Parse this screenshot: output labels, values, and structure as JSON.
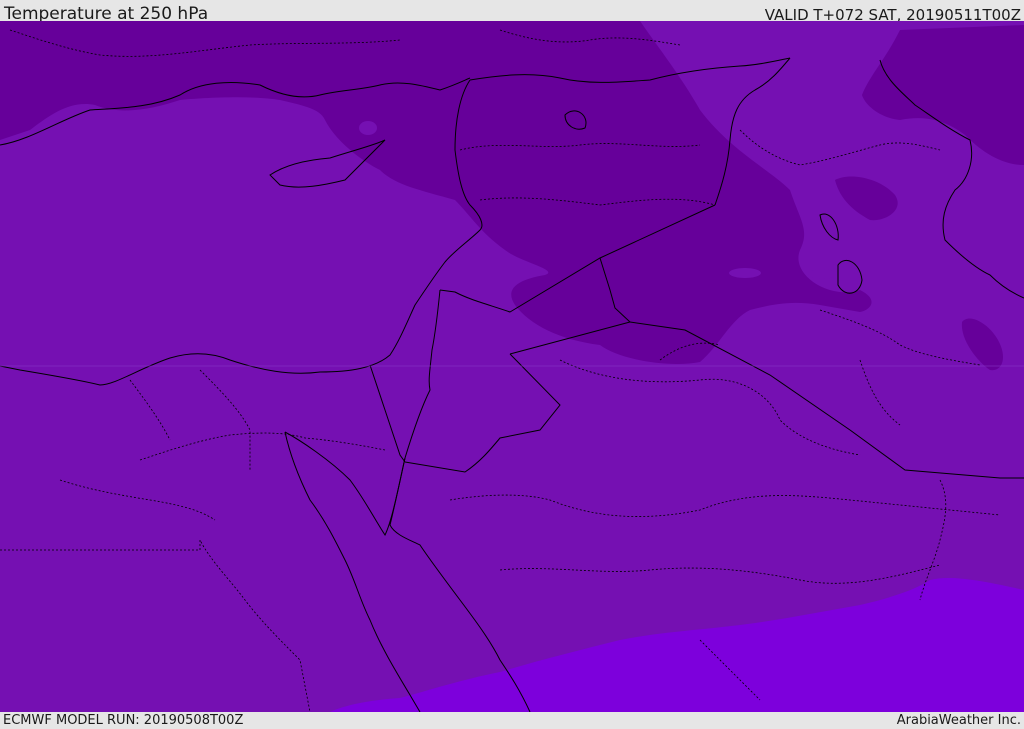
{
  "header": {
    "title": "Temperature at 250 hPa",
    "valid_time": "VALID T+072 SAT, 20190511T00Z"
  },
  "footer": {
    "model_run": "ECMWF MODEL RUN: 20190508T00Z",
    "credit": "ArabiaWeather Inc."
  },
  "colors": {
    "field_main": "#7510b2",
    "field_cold": "#66009a",
    "field_warm": "#7d00dc",
    "border": "#000000"
  }
}
